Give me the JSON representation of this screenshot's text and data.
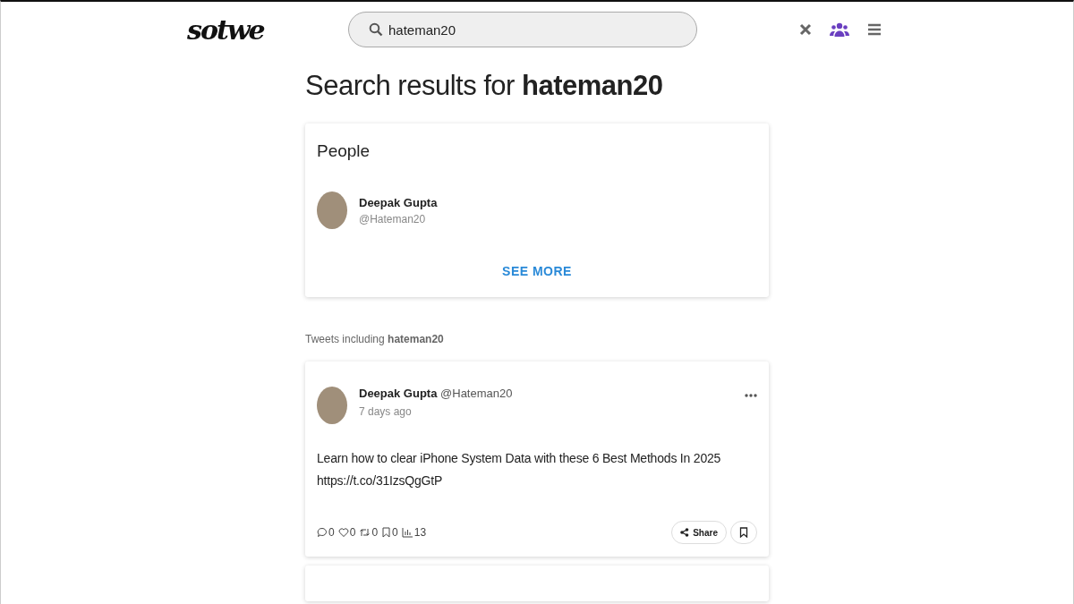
{
  "header": {
    "logo": "sotwe",
    "search": {
      "value": "hateman20"
    }
  },
  "heading": "Search results for **hateman20**",
  "people": {
    "title": "People",
    "items": [
      {
        "name": "Deepak Gupta",
        "handle": "@Hateman20"
      }
    ],
    "see_more": "SEE MORE"
  },
  "tweets_label": "Tweets including **hateman20**",
  "tweets": [
    {
      "name": "Deepak Gupta",
      "handle": "@Hateman20",
      "time": "7 days ago",
      "text": "Learn how to clear iPhone System Data with these 6 Best Methods In 2025",
      "link": "https://t.co/31IzsQgGtP",
      "stats": [
        {
          "kind": "reply",
          "count": "0"
        },
        {
          "kind": "like",
          "count": "0"
        },
        {
          "kind": "retweet",
          "count": "0"
        },
        {
          "kind": "bookmark",
          "count": "0"
        },
        {
          "kind": "views",
          "count": "13"
        }
      ],
      "share": "Share"
    }
  ]
}
